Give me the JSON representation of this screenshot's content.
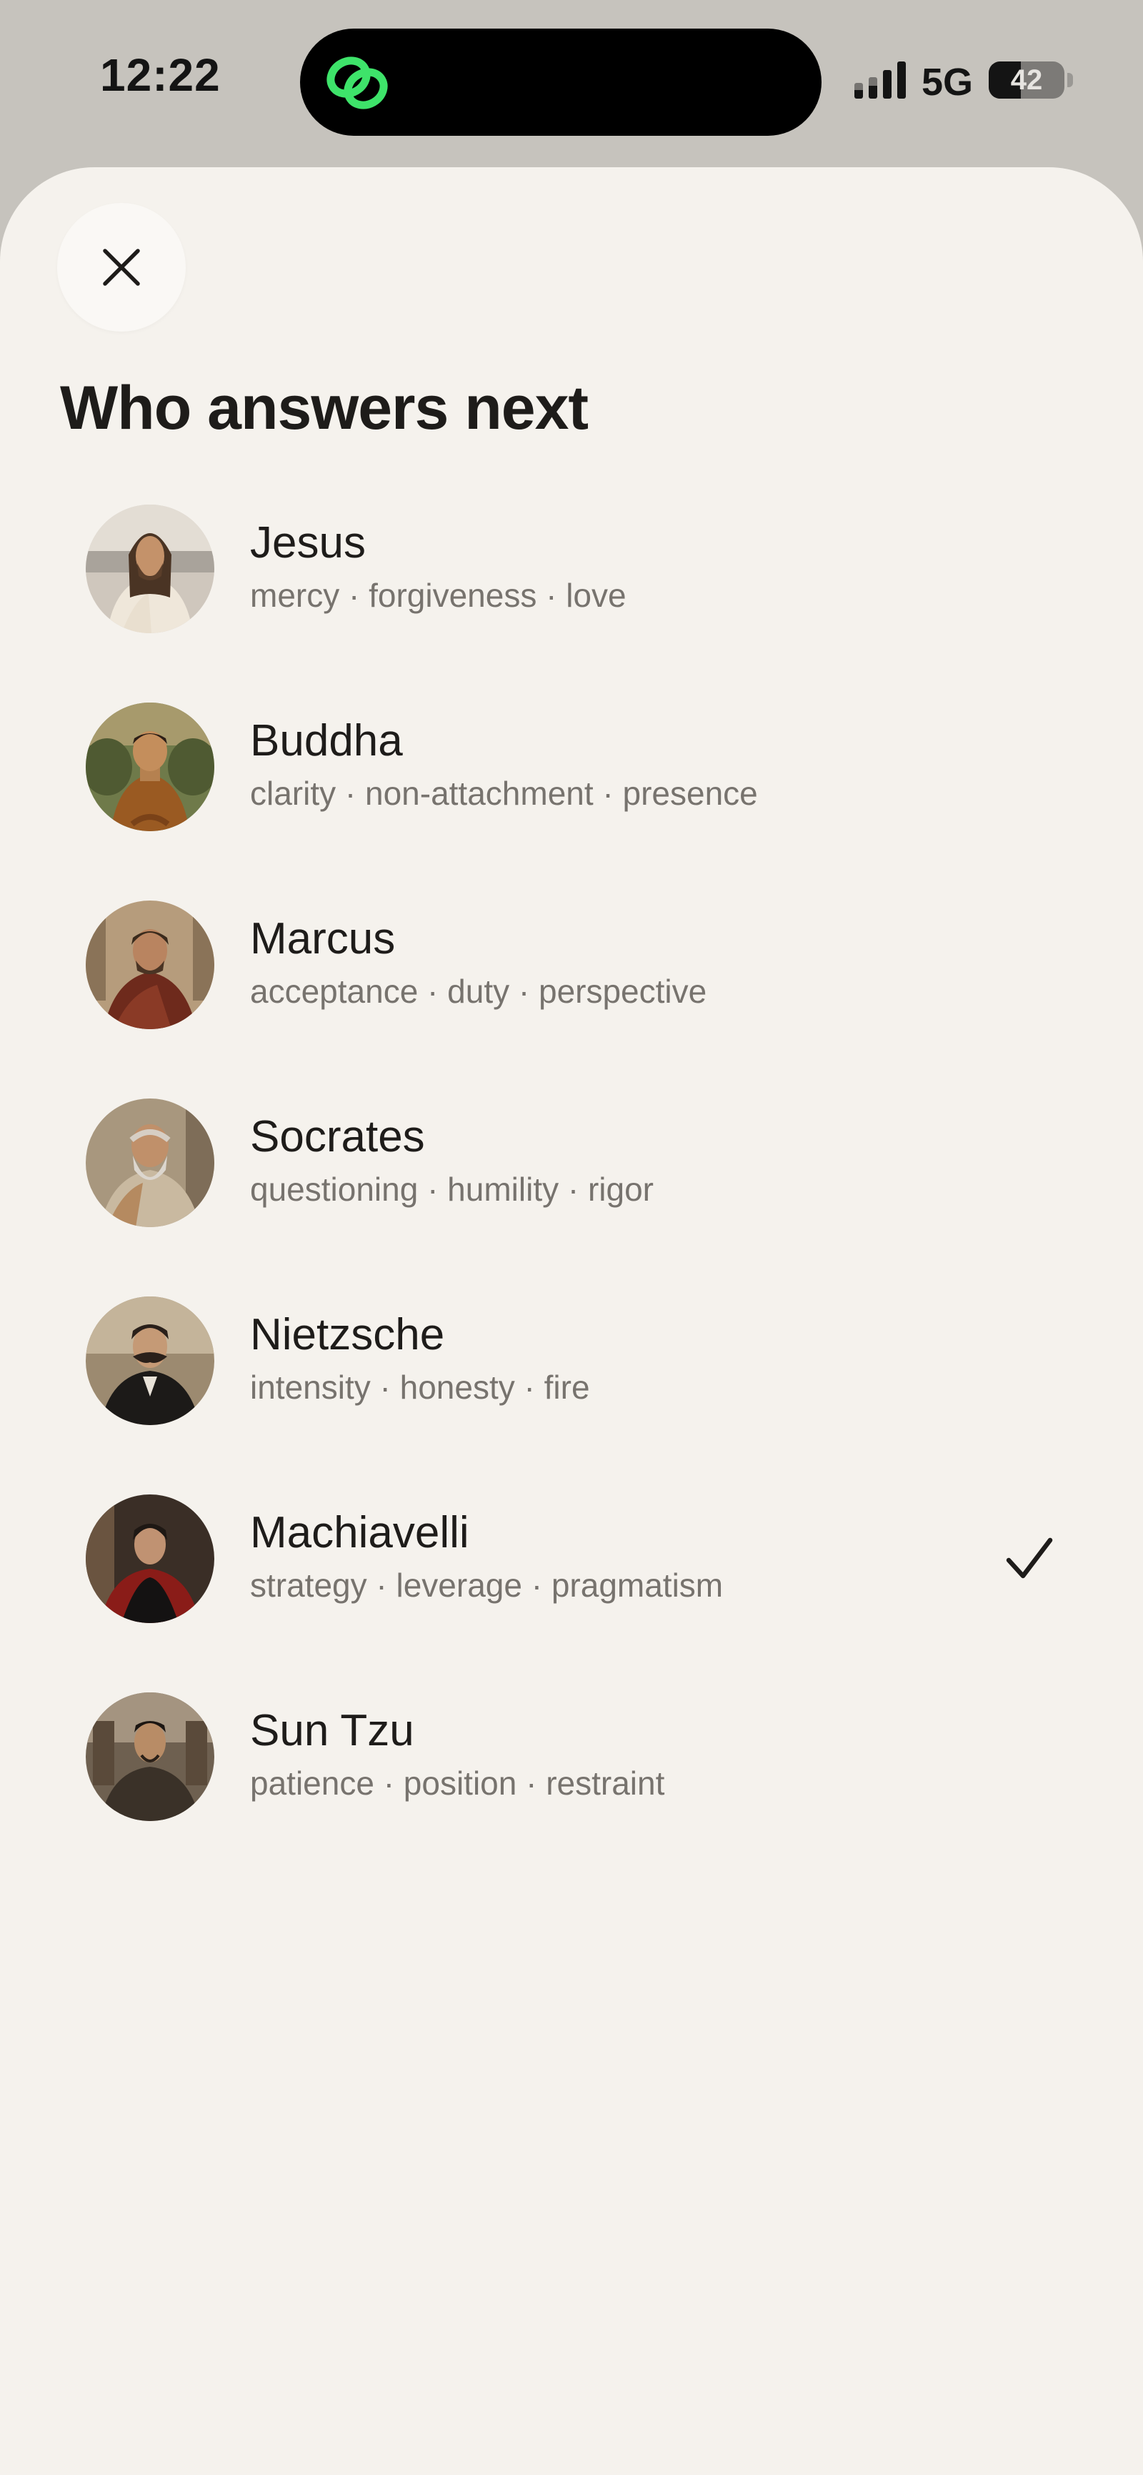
{
  "status_bar": {
    "time": "12:22",
    "network": "5G",
    "battery": "42",
    "battery_level_percent": 42
  },
  "sheet": {
    "close_icon": "close-icon",
    "title": "Who answers next"
  },
  "personas": [
    {
      "name": "Jesus",
      "traits": "mercy · forgiveness · love",
      "selected": false
    },
    {
      "name": "Buddha",
      "traits": "clarity · non-attachment · presence",
      "selected": false
    },
    {
      "name": "Marcus",
      "traits": "acceptance · duty · perspective",
      "selected": false
    },
    {
      "name": "Socrates",
      "traits": "questioning · humility · rigor",
      "selected": false
    },
    {
      "name": "Nietzsche",
      "traits": "intensity · honesty · fire",
      "selected": false
    },
    {
      "name": "Machiavelli",
      "traits": "strategy · leverage · pragmatism",
      "selected": true
    },
    {
      "name": "Sun Tzu",
      "traits": "patience · position · restraint",
      "selected": false
    }
  ],
  "colors": {
    "sheet_background": "#f5f2ed",
    "app_icon_green": "#3ee36a",
    "text_primary": "#1e1c1a",
    "text_secondary": "#77736e"
  }
}
